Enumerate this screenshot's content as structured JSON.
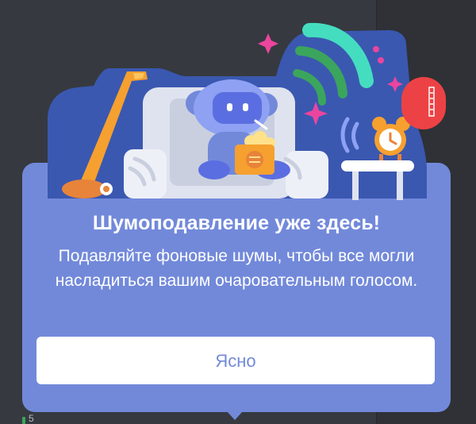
{
  "popup": {
    "title": "Шумоподавление уже здесь!",
    "description": "Подавляйте фоновые шумы, чтобы все могли насладиться вашим очаровательным голосом.",
    "button_label": "Ясно"
  },
  "background": {
    "fragment_text": "5"
  },
  "colors": {
    "popup_bg": "#7289da",
    "scene_bg": "#3a58b0",
    "button_text": "#7289da",
    "badge_red": "#ed4245",
    "app_bg": "#36393f",
    "app_panel": "#2f3136"
  },
  "icons": [
    "vacuum-cleaner-icon",
    "mascot-icon",
    "armchair-icon",
    "popcorn-icon",
    "alarm-clock-icon",
    "side-table-icon",
    "sound-wave-icon",
    "sparkle-icon",
    "notification-badge-icon"
  ]
}
